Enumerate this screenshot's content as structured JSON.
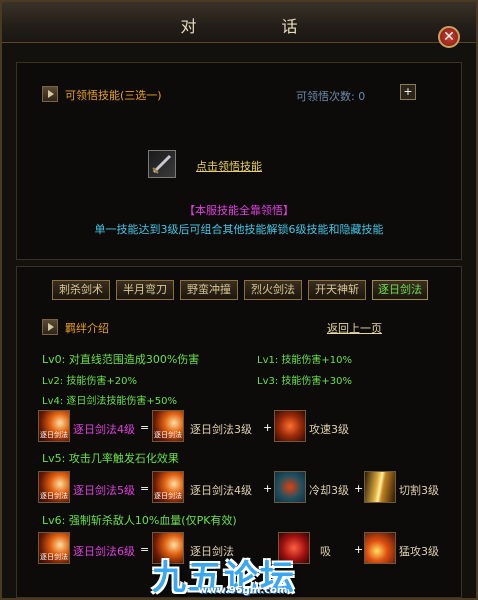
{
  "window": {
    "title": "对 话",
    "close_icon": "close-icon"
  },
  "top": {
    "section_title": "可领悟技能(三选一)",
    "count_label": "可领悟次数: 0",
    "plus_label": "+",
    "learn_link": "点击领悟技能",
    "notice": "【本服技能全靠领悟】",
    "desc": "单一技能达到3级后可组合其他技能解锁6级技能和隐藏技能"
  },
  "tabs": [
    {
      "label": "刺杀剑术",
      "active": false
    },
    {
      "label": "半月弯刀",
      "active": false
    },
    {
      "label": "野蛮冲撞",
      "active": false
    },
    {
      "label": "烈火剑法",
      "active": false
    },
    {
      "label": "开天神斩",
      "active": false
    },
    {
      "label": "逐日剑法",
      "active": true
    }
  ],
  "detail": {
    "section_title": "羁绊介绍",
    "back_link": "返回上一页",
    "lv0": "Lv0: 对直线范围造成300%伤害",
    "lv1": "Lv1: 技能伤害+10%",
    "lv2": "Lv2: 技能伤害+20%",
    "lv3": "Lv3: 技能伤害+30%",
    "lv4": "Lv4: 逐日剑法技能伤害+50%",
    "icon_caption": "逐日剑法",
    "row1": {
      "result": "逐日剑法4级",
      "eq": "=",
      "base": "逐日剑法3级",
      "plus": "+",
      "extra": "攻速3级"
    },
    "lv5": "Lv5: 攻击几率触发石化效果",
    "row2": {
      "result": "逐日剑法5级",
      "eq": "=",
      "base": "逐日剑法4级",
      "plus1": "+",
      "extra1": "冷却3级",
      "plus2": "+",
      "extra2": "切割3级"
    },
    "lv6": "Lv6: 强制斩杀敌人10%血量(仅PK有效)",
    "row3": {
      "result": "逐日剑法6级",
      "eq": "=",
      "base": "逐日剑法",
      "plus1": "+",
      "extra1": "吸",
      "plus2": "+",
      "extra2": "猛攻3级"
    }
  },
  "watermark": {
    "logo_text": "九五论坛",
    "url": "www.95gm.com"
  }
}
